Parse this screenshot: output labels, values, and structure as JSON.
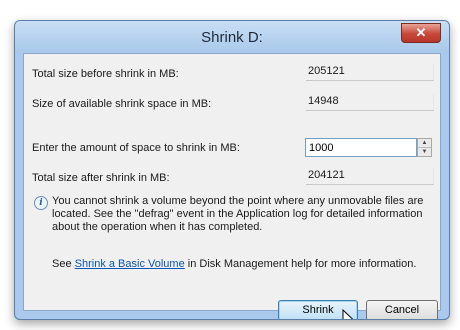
{
  "window": {
    "title": "Shrink D:",
    "close_glyph": "✕"
  },
  "fields": [
    {
      "label": "Total size before shrink in MB:",
      "value": "205121"
    },
    {
      "label": "Size of available shrink space in MB:",
      "value": "14948"
    },
    {
      "label": "Enter the amount of space to shrink in MB:",
      "value": "1000"
    },
    {
      "label": "Total size after shrink in MB:",
      "value": "204121"
    }
  ],
  "info": {
    "icon": "info-icon",
    "glyph": "i",
    "text": "You cannot shrink a volume beyond the point where any unmovable files are located. See the \"defrag\" event in the Application log for detailed information about the operation when it has completed."
  },
  "help": {
    "prefix": "See ",
    "link": "Shrink a Basic Volume",
    "suffix": " in Disk Management help for more information."
  },
  "buttons": {
    "shrink": "Shrink",
    "cancel": "Cancel"
  },
  "colors": {
    "title_bar": "#aac9ec",
    "close_button": "#c7483a",
    "link": "#0b56b8",
    "dialog_body": "#f0f0f0"
  }
}
